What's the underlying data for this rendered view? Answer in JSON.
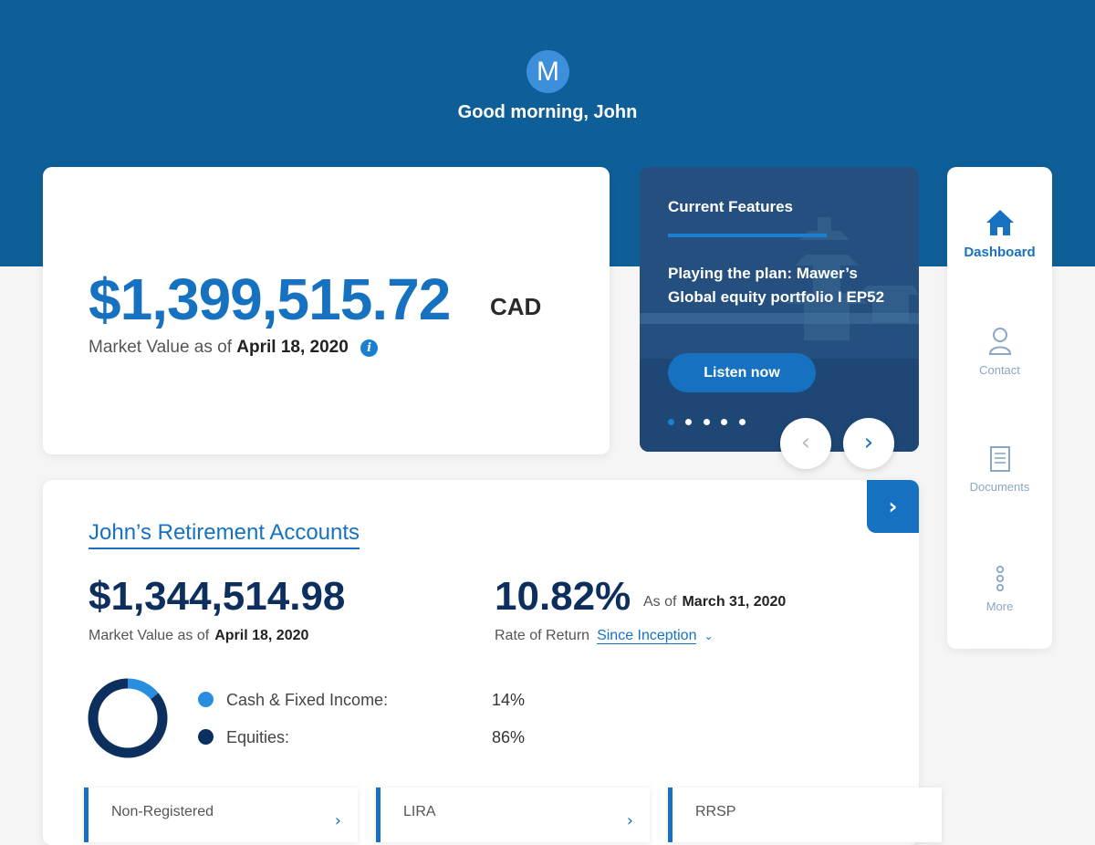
{
  "header": {
    "avatar_initial": "M",
    "greeting": "Good morning, John"
  },
  "portfolio": {
    "amount": "$1,399,515.72",
    "currency": "CAD",
    "sub_label": "Market Value as of",
    "sub_date": "April 18, 2020",
    "info_glyph": "i"
  },
  "features": {
    "title": "Current Features",
    "text": "Playing the plan: Mawer’s Global equity portfolio I EP52",
    "button_label": "Listen now",
    "slide_count": 5,
    "active_slide": 1,
    "prev_glyph": "‹",
    "next_glyph": "›"
  },
  "sidenav": {
    "items": [
      {
        "label": "Dashboard",
        "icon": "home-icon",
        "active": true
      },
      {
        "label": "Contact",
        "icon": "person-icon",
        "active": false
      },
      {
        "label": "Documents",
        "icon": "document-icon",
        "active": false
      },
      {
        "label": "More",
        "icon": "more-vertical-icon",
        "active": false
      }
    ]
  },
  "accounts": {
    "title": "John’s Retirement Accounts",
    "go_glyph": "›",
    "amount": "$1,344,514.98",
    "sub_label": "Market Value as of",
    "sub_date": "April 18, 2020",
    "ror_value": "10.82%",
    "ror_asof_label": "As of",
    "ror_asof_date": "March 31, 2020",
    "ror_label": "Rate of Return",
    "ror_period": "Since Inception",
    "ror_chevron": "⌄",
    "allocation": [
      {
        "label": "Cash & Fixed Income:",
        "pct": "14%",
        "value": 14,
        "color": "#2a8ee0"
      },
      {
        "label": "Equities:",
        "pct": "86%",
        "value": 86,
        "color": "#0c2f5e"
      }
    ],
    "sub_accounts": [
      {
        "label": "Non-Registered"
      },
      {
        "label": "LIRA"
      },
      {
        "label": "RRSP"
      }
    ]
  },
  "colors": {
    "brand": "#0e5f98",
    "accent": "#1672c0",
    "navy": "#0c2f5e"
  }
}
